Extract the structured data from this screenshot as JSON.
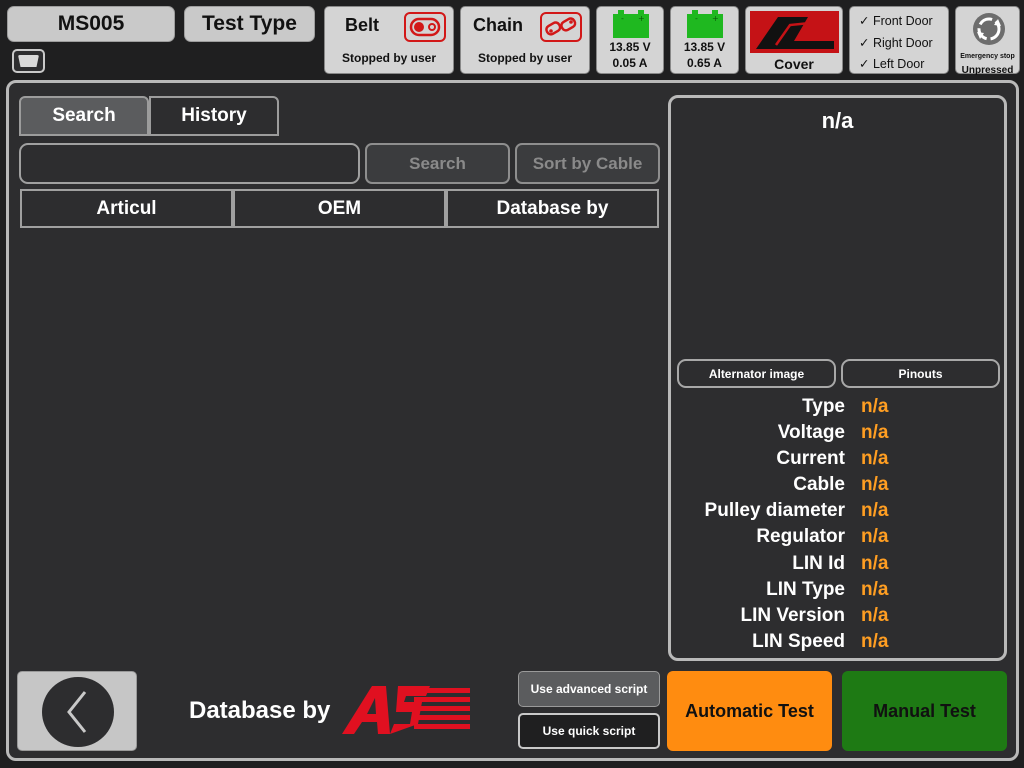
{
  "header": {
    "station_id": "MS005",
    "test_type_label": "Test Type",
    "belt": {
      "title": "Belt",
      "status": "Stopped by user",
      "icon": "belt-pulley-icon"
    },
    "chain": {
      "title": "Chain",
      "status": "Stopped by user",
      "icon": "chain-icon"
    },
    "battery1": {
      "voltage": "13.85 V",
      "current": "0.05 A",
      "icon": "battery-icon"
    },
    "battery2": {
      "voltage": "13.85 V",
      "current": "0.65 A",
      "icon": "battery-icon"
    },
    "cover": {
      "label": "Cover",
      "icon": "cover-open-icon"
    },
    "doors": [
      {
        "label": "Front Door",
        "mark": "✓"
      },
      {
        "label": "Right Door",
        "mark": "✓"
      },
      {
        "label": "Left Door",
        "mark": "✓"
      }
    ],
    "emergency": {
      "label": "Emergency stop",
      "status": "Unpressed",
      "icon": "emergency-stop-icon"
    },
    "keyboard_icon": "keyboard-icon"
  },
  "tabs": [
    {
      "label": "Search",
      "active": true
    },
    {
      "label": "History",
      "active": false
    }
  ],
  "search": {
    "query": "",
    "search_button": "Search",
    "sort_button": "Sort by Cable"
  },
  "table": {
    "columns": [
      "Articul",
      "OEM",
      "Database by"
    ],
    "rows": []
  },
  "details": {
    "title": "n/a",
    "image_button": "Alternator image",
    "pinouts_button": "Pinouts",
    "properties": [
      {
        "label": "Type",
        "value": "n/a"
      },
      {
        "label": "Voltage",
        "value": "n/a"
      },
      {
        "label": "Current",
        "value": "n/a"
      },
      {
        "label": "Cable",
        "value": "n/a"
      },
      {
        "label": "Pulley diameter",
        "value": "n/a"
      },
      {
        "label": "Regulator",
        "value": "n/a"
      },
      {
        "label": "LIN Id",
        "value": "n/a"
      },
      {
        "label": "LIN Type",
        "value": "n/a"
      },
      {
        "label": "LIN Version",
        "value": "n/a"
      },
      {
        "label": "LIN Speed",
        "value": "n/a"
      }
    ]
  },
  "footer": {
    "back_icon": "chevron-left-icon",
    "database_by": "Database by",
    "logo_text": "AS",
    "advanced_script": "Use advanced script",
    "quick_script": "Use quick script",
    "automatic_test": "Automatic Test",
    "manual_test": "Manual Test"
  },
  "colors": {
    "value_orange": "#ff9e22",
    "automatic_bg": "#ff8c10",
    "manual_bg": "#1e7a14",
    "logo_red": "#e01020",
    "battery_green": "#1fb820"
  }
}
